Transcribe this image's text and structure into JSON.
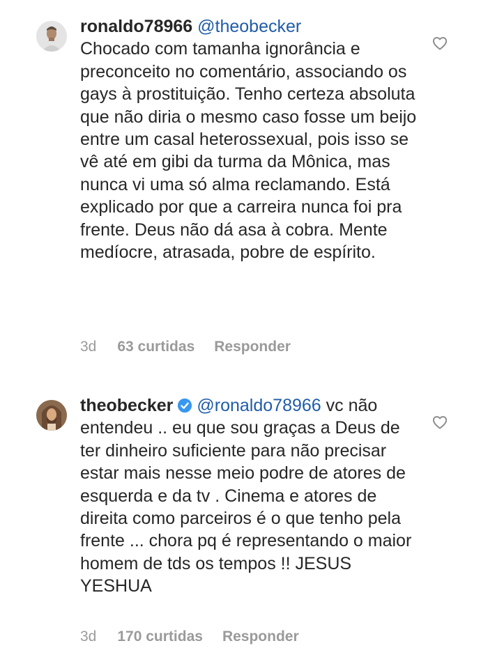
{
  "comments": [
    {
      "username": "ronaldo78966",
      "mention": "@theobecker",
      "verified": false,
      "text": "Chocado com tamanha ignorância e preconceito no comentário, associando os gays à prostituição. Tenho certeza absoluta que não diria o mesmo caso fosse um beijo entre um casal heterossexual, pois isso se vê até em gibi da turma da Mônica, mas nunca vi uma só alma reclamando. Está explicado por que a carreira nunca foi pra frente. Deus não dá asa à cobra. Mente medíocre, atrasada, pobre de espírito.",
      "time": "3d",
      "likes": "63 curtidas",
      "reply_label": "Responder"
    },
    {
      "username": "theobecker",
      "mention": "@ronaldo78966",
      "verified": true,
      "text": "vc não entendeu .. eu que sou graças a Deus de ter dinheiro suficiente para não precisar estar mais nesse meio podre de atores de esquerda e da tv . Cinema e atores de direita como parceiros é o que tenho pela frente ... chora pq é representando o maior homem de tds os tempos !! JESUS YESHUA",
      "time": "3d",
      "likes": "170 curtidas",
      "reply_label": "Responder"
    }
  ],
  "colors": {
    "text": "#262626",
    "mention": "#1f5ca8",
    "meta": "#9a9a9a",
    "verified_badge": "#3897f0"
  },
  "icons": {
    "like": "heart-outline-icon",
    "verified": "verified-badge-icon"
  }
}
